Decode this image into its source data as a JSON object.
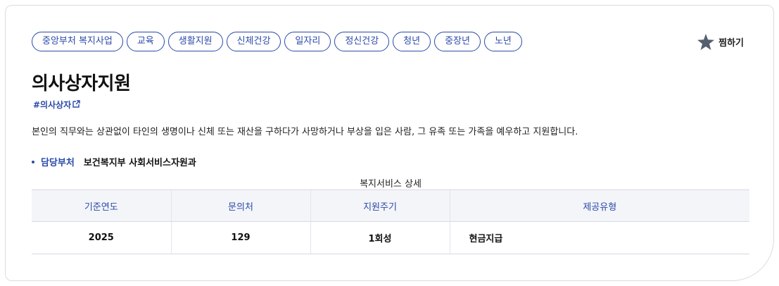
{
  "tags": [
    "중앙부처 복지사업",
    "교육",
    "생활지원",
    "신체건강",
    "일자리",
    "정신건강",
    "청년",
    "중장년",
    "노년"
  ],
  "favorite_label": "찜하기",
  "title": "의사상자지원",
  "hashtag": "#의사상자",
  "description": "본인의 직무와는 상관없이 타인의 생명이나 신체 또는 재산을 구하다가 사망하거나 부상을 입은 사람, 그 유족 또는 가족을 예우하고 지원합니다.",
  "department": {
    "label": "담당부처",
    "value": "보건복지부 사회서비스자원과"
  },
  "table": {
    "caption": "복지서비스 상세",
    "headers": [
      "기준연도",
      "문의처",
      "지원주기",
      "제공유형"
    ],
    "row": [
      "2025",
      "129",
      "1회성",
      "현금지급"
    ]
  },
  "colors": {
    "accent": "#2a4aa8",
    "star": "#555f6d",
    "header_bg": "#f4f5f9"
  }
}
